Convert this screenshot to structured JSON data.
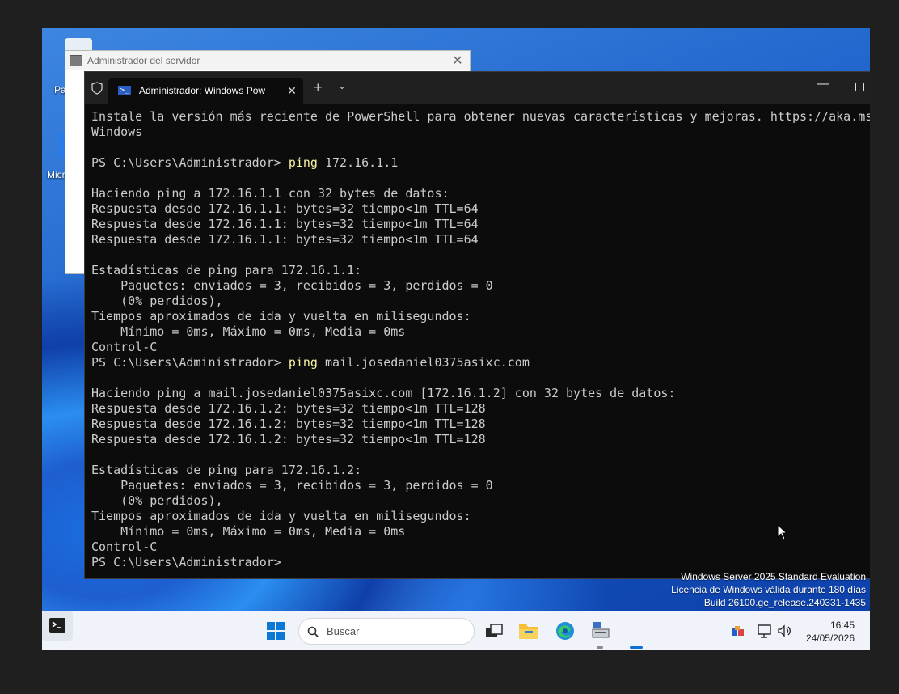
{
  "desktop": {
    "icon1_label": "Pa r",
    "icon2_label": "Micr"
  },
  "server_manager": {
    "title": "Administrador del servidor",
    "close": "✕"
  },
  "terminal": {
    "tab_title": "Administrador: Windows Pow",
    "tab_close": "✕",
    "new_tab": "+",
    "dropdown": "⌄",
    "minimize": "—",
    "lines": [
      {
        "prompt": "",
        "cmd": "",
        "rest": "Instale la versión más reciente de PowerShell para obtener nuevas características y mejoras. https://aka.ms"
      },
      {
        "prompt": "",
        "cmd": "",
        "rest": "Windows"
      },
      {
        "prompt": "",
        "cmd": "",
        "rest": ""
      },
      {
        "prompt": "PS C:\\Users\\Administrador> ",
        "cmd": "ping",
        "rest": " 172.16.1.1"
      },
      {
        "prompt": "",
        "cmd": "",
        "rest": ""
      },
      {
        "prompt": "",
        "cmd": "",
        "rest": "Haciendo ping a 172.16.1.1 con 32 bytes de datos:"
      },
      {
        "prompt": "",
        "cmd": "",
        "rest": "Respuesta desde 172.16.1.1: bytes=32 tiempo<1m TTL=64"
      },
      {
        "prompt": "",
        "cmd": "",
        "rest": "Respuesta desde 172.16.1.1: bytes=32 tiempo<1m TTL=64"
      },
      {
        "prompt": "",
        "cmd": "",
        "rest": "Respuesta desde 172.16.1.1: bytes=32 tiempo<1m TTL=64"
      },
      {
        "prompt": "",
        "cmd": "",
        "rest": ""
      },
      {
        "prompt": "",
        "cmd": "",
        "rest": "Estadísticas de ping para 172.16.1.1:"
      },
      {
        "prompt": "",
        "cmd": "",
        "rest": "    Paquetes: enviados = 3, recibidos = 3, perdidos = 0"
      },
      {
        "prompt": "",
        "cmd": "",
        "rest": "    (0% perdidos),"
      },
      {
        "prompt": "",
        "cmd": "",
        "rest": "Tiempos aproximados de ida y vuelta en milisegundos:"
      },
      {
        "prompt": "",
        "cmd": "",
        "rest": "    Mínimo = 0ms, Máximo = 0ms, Media = 0ms"
      },
      {
        "prompt": "",
        "cmd": "",
        "rest": "Control-C"
      },
      {
        "prompt": "PS C:\\Users\\Administrador> ",
        "cmd": "ping",
        "rest": " mail.josedaniel0375asixc.com"
      },
      {
        "prompt": "",
        "cmd": "",
        "rest": ""
      },
      {
        "prompt": "",
        "cmd": "",
        "rest": "Haciendo ping a mail.josedaniel0375asixc.com [172.16.1.2] con 32 bytes de datos:"
      },
      {
        "prompt": "",
        "cmd": "",
        "rest": "Respuesta desde 172.16.1.2: bytes=32 tiempo<1m TTL=128"
      },
      {
        "prompt": "",
        "cmd": "",
        "rest": "Respuesta desde 172.16.1.2: bytes=32 tiempo<1m TTL=128"
      },
      {
        "prompt": "",
        "cmd": "",
        "rest": "Respuesta desde 172.16.1.2: bytes=32 tiempo<1m TTL=128"
      },
      {
        "prompt": "",
        "cmd": "",
        "rest": ""
      },
      {
        "prompt": "",
        "cmd": "",
        "rest": "Estadísticas de ping para 172.16.1.2:"
      },
      {
        "prompt": "",
        "cmd": "",
        "rest": "    Paquetes: enviados = 3, recibidos = 3, perdidos = 0"
      },
      {
        "prompt": "",
        "cmd": "",
        "rest": "    (0% perdidos),"
      },
      {
        "prompt": "",
        "cmd": "",
        "rest": "Tiempos aproximados de ida y vuelta en milisegundos:"
      },
      {
        "prompt": "",
        "cmd": "",
        "rest": "    Mínimo = 0ms, Máximo = 0ms, Media = 0ms"
      },
      {
        "prompt": "",
        "cmd": "",
        "rest": "Control-C"
      },
      {
        "prompt": "PS C:\\Users\\Administrador> ",
        "cmd": "",
        "rest": ""
      }
    ]
  },
  "watermark": {
    "line1": "Windows Server 2025 Standard Evaluation",
    "line2": "Licencia de Windows válida durante 180 días",
    "line3": "Build 26100.ge_release.240331-1435"
  },
  "taskbar": {
    "search_placeholder": "Buscar",
    "time": "16:45",
    "date": "24/05/2026"
  },
  "icons": {
    "shield": "shield-icon",
    "powershell": "powershell-icon",
    "start": "windows-start-icon",
    "search": "search-icon",
    "task_view": "task-view-icon",
    "explorer": "folder-icon",
    "edge": "edge-browser-icon",
    "server_manager": "server-manager-icon",
    "terminal": "terminal-icon",
    "network": "network-icon",
    "display": "display-icon",
    "volume": "volume-icon"
  },
  "colors": {
    "terminal_bg": "#0c0c0c",
    "terminal_text": "#cccccc",
    "command_highlight": "#f9f1a5",
    "accent": "#0a78d4"
  }
}
